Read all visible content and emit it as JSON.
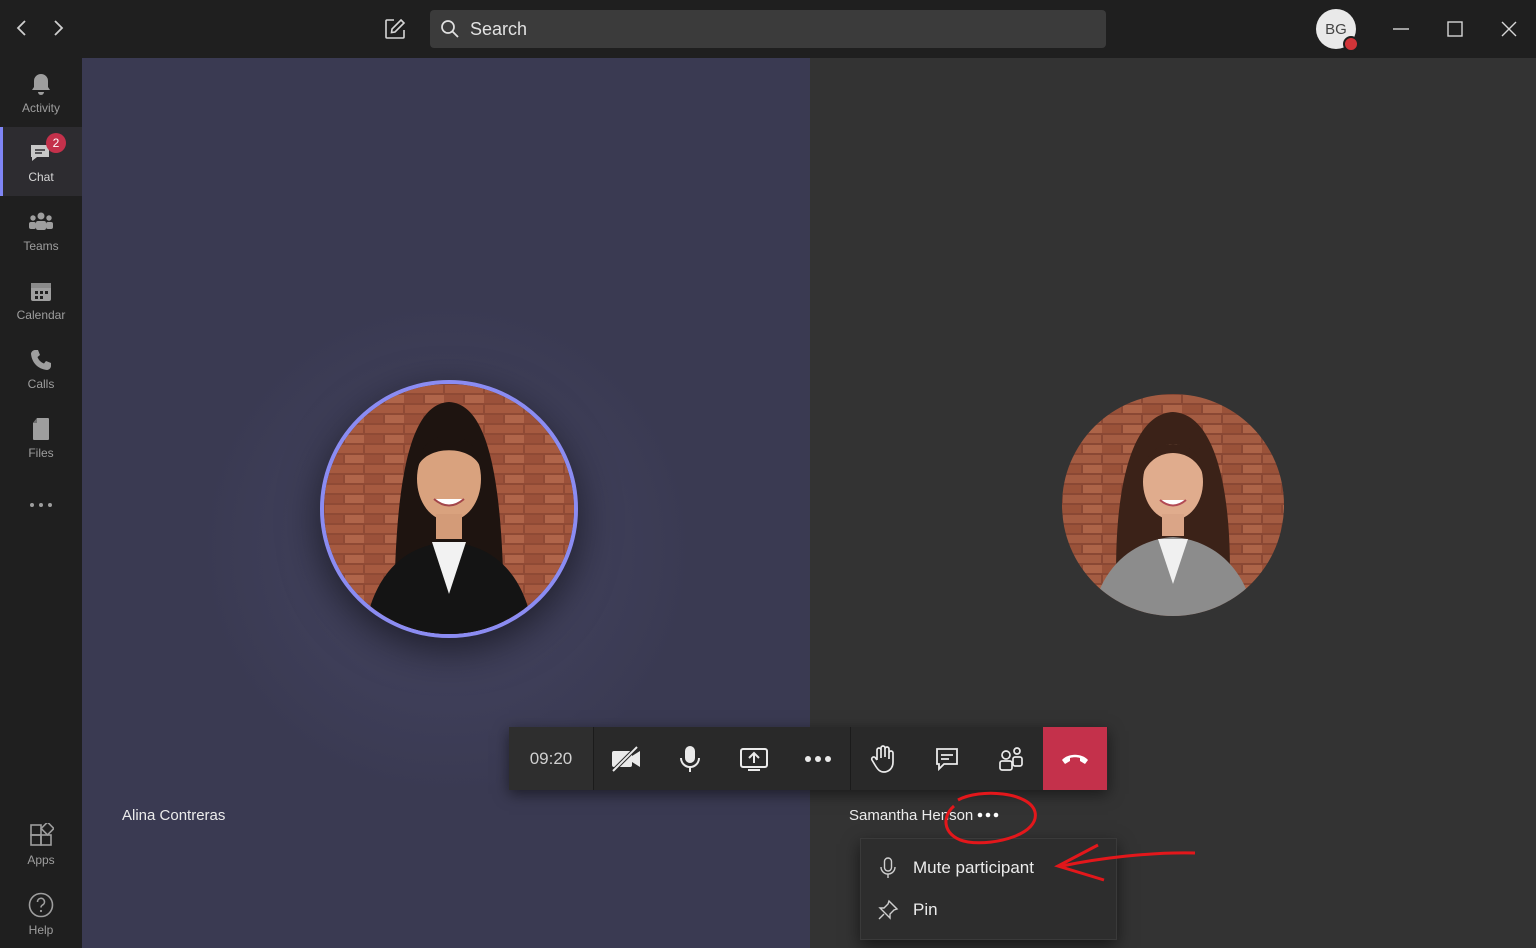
{
  "search": {
    "placeholder": "Search"
  },
  "user": {
    "initials": "BG"
  },
  "rail": {
    "items": [
      {
        "label": "Activity",
        "icon": "bell-icon"
      },
      {
        "label": "Chat",
        "icon": "chat-icon",
        "badge": "2",
        "active": true
      },
      {
        "label": "Teams",
        "icon": "teams-icon"
      },
      {
        "label": "Calendar",
        "icon": "calendar-icon"
      },
      {
        "label": "Calls",
        "icon": "phone-icon"
      },
      {
        "label": "Files",
        "icon": "file-icon"
      },
      {
        "label": "Apps",
        "icon": "apps-icon"
      },
      {
        "label": "Help",
        "icon": "help-icon"
      }
    ]
  },
  "participants": [
    {
      "name": "Alina Contreras",
      "speaking": true
    },
    {
      "name": "Samantha Henson"
    }
  ],
  "callbar": {
    "timer": "09:20"
  },
  "context_menu": {
    "items": [
      {
        "label": "Mute participant",
        "icon": "microphone-icon"
      },
      {
        "label": "Pin",
        "icon": "pin-icon"
      }
    ]
  },
  "colors": {
    "accent": "#7f85f5",
    "hangup": "#c4314b",
    "presence_busy": "#d13438",
    "annotation": "#e3171b"
  }
}
